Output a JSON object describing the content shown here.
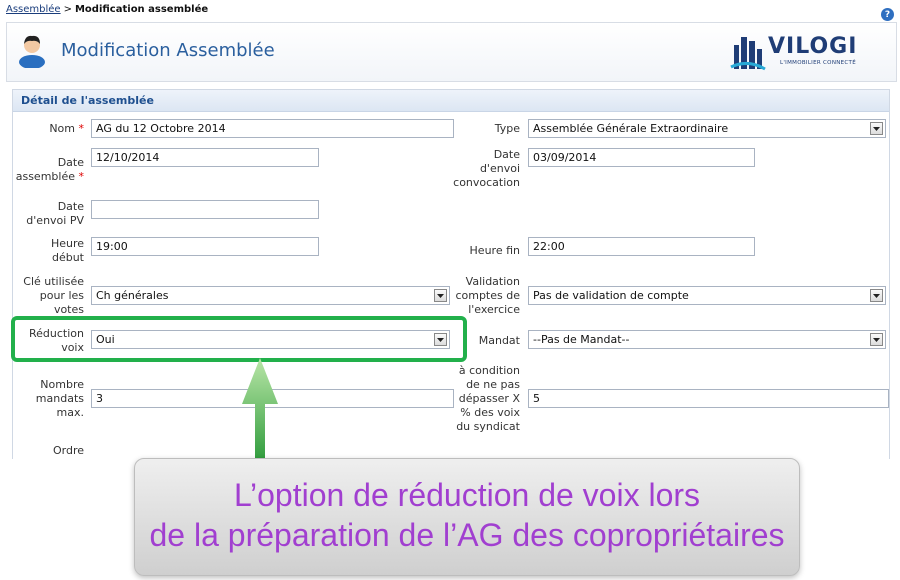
{
  "breadcrumb": {
    "link": "Assemblée",
    "separator": ">",
    "current": "Modification assemblée"
  },
  "help": {
    "glyph": "?"
  },
  "header": {
    "title": "Modification Assemblée"
  },
  "logo": {
    "brand": "VILOGI",
    "tagline": "L'IMMOBILIER CONNECTÉ"
  },
  "panel": {
    "title": "Détail de l'assemblée"
  },
  "form": {
    "nom": {
      "label": "Nom",
      "value": "AG du 12 Octobre 2014"
    },
    "type": {
      "label": "Type",
      "value": "Assemblée Générale Extraordinaire"
    },
    "date_assemblee": {
      "label_line1": "Date",
      "label_line2": "assemblée",
      "value": "12/10/2014"
    },
    "date_envoi_convocation": {
      "label_line1": "Date",
      "label_line2": "d'envoi",
      "label_line3": "convocation",
      "value": "03/09/2014"
    },
    "date_envoi_pv": {
      "label_line1": "Date",
      "label_line2": "d'envoi PV",
      "value": ""
    },
    "heure_debut": {
      "label_line1": "Heure",
      "label_line2": "début",
      "value": "19:00"
    },
    "heure_fin": {
      "label": "Heure fin",
      "value": "22:00"
    },
    "cle": {
      "label_line1": "Clé utilisée",
      "label_line2": "pour les",
      "label_line3": "votes",
      "value": "Ch générales"
    },
    "validation": {
      "label_line1": "Validation",
      "label_line2": "comptes de",
      "label_line3": "l'exercice",
      "value": "Pas de validation de compte"
    },
    "reduction": {
      "label_line1": "Réduction",
      "label_line2": "voix",
      "value": "Oui"
    },
    "mandat": {
      "label": "Mandat",
      "value": "--Pas de Mandat--"
    },
    "nombre_mandats": {
      "label_line1": "Nombre",
      "label_line2": "mandats",
      "label_line3": "max.",
      "value": "3"
    },
    "condition": {
      "label_line1": "à condition",
      "label_line2": "de ne pas",
      "label_line3": "dépasser X",
      "label_line4": "% des voix",
      "label_line5": "du syndicat",
      "value": "5"
    },
    "ordre": {
      "label": "Ordre"
    }
  },
  "caption": {
    "line1": "L’option de réduction de voix lors",
    "line2": "de la préparation de l’AG des copropriétaires"
  },
  "colors": {
    "accent_green": "#22b04b",
    "caption_text": "#a13fd0",
    "title_blue": "#2a5f9e"
  }
}
